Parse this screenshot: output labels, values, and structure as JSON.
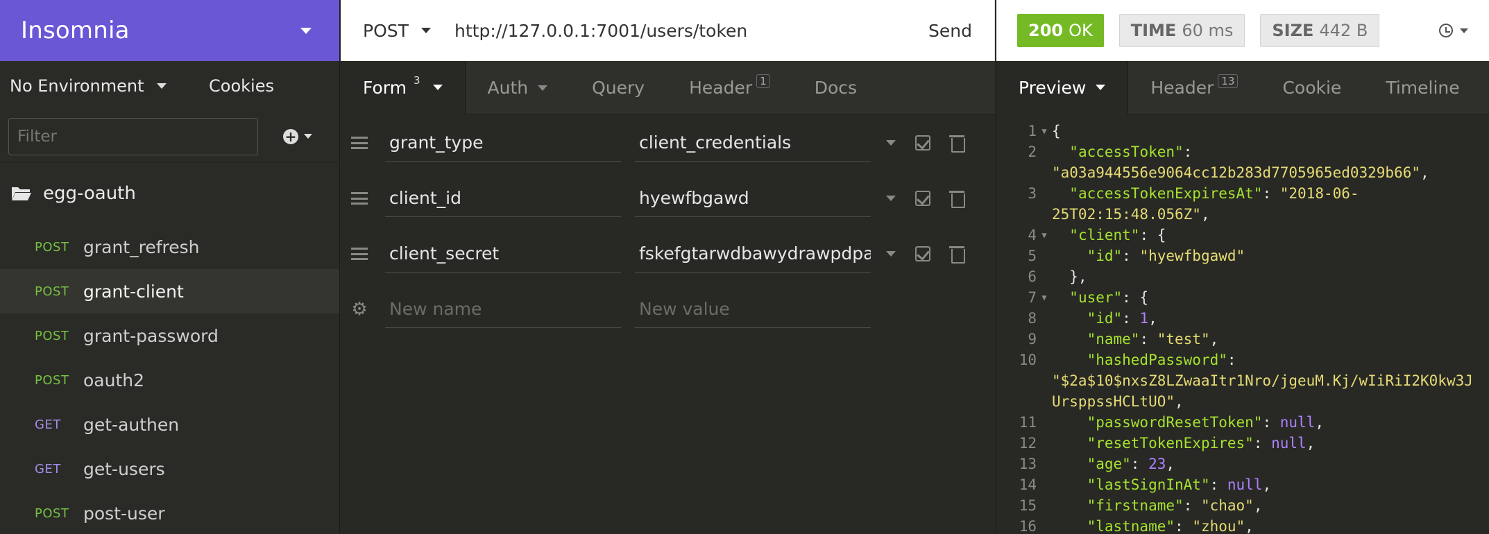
{
  "sidebar": {
    "app_title": "Insomnia",
    "environment": "No Environment",
    "cookies": "Cookies",
    "filter_placeholder": "Filter",
    "folder": "egg-oauth",
    "requests": [
      {
        "method": "POST",
        "name": "grant_refresh"
      },
      {
        "method": "POST",
        "name": "grant-client"
      },
      {
        "method": "POST",
        "name": "grant-password"
      },
      {
        "method": "POST",
        "name": "oauth2"
      },
      {
        "method": "GET",
        "name": "get-authen"
      },
      {
        "method": "GET",
        "name": "get-users"
      },
      {
        "method": "POST",
        "name": "post-user"
      }
    ]
  },
  "request": {
    "method": "POST",
    "url": "http://127.0.0.1:7001/users/token",
    "send_label": "Send",
    "tabs": {
      "form": "Form",
      "form_count": "3",
      "auth": "Auth",
      "query": "Query",
      "header": "Header",
      "header_count": "1",
      "docs": "Docs"
    },
    "params": [
      {
        "name": "grant_type",
        "value": "client_credentials"
      },
      {
        "name": "client_id",
        "value": "hyewfbgawd"
      },
      {
        "name": "client_secret",
        "value": "fskefgtarwdbawydrawpdpa"
      }
    ],
    "new_name_placeholder": "New name",
    "new_value_placeholder": "New value"
  },
  "response": {
    "status_code": "200",
    "status_text": "OK",
    "time_label": "TIME",
    "time_value": "60 ms",
    "size_label": "SIZE",
    "size_value": "442 B",
    "tabs": {
      "preview": "Preview",
      "header": "Header",
      "header_count": "13",
      "cookie": "Cookie",
      "timeline": "Timeline"
    },
    "lines": [
      {
        "n": "1",
        "fold": true,
        "html": "{"
      },
      {
        "n": "2",
        "fold": false,
        "parts": [
          [
            "",
            "  "
          ],
          [
            "k",
            "\"accessToken\""
          ],
          [
            "",
            ":"
          ]
        ]
      },
      {
        "n": "",
        "fold": false,
        "parts": [
          [
            "s",
            "\"a03a944556e9064cc12b283d7705965ed0329b66\""
          ],
          [
            "",
            ","
          ]
        ]
      },
      {
        "n": "3",
        "fold": false,
        "parts": [
          [
            "",
            "  "
          ],
          [
            "k",
            "\"accessTokenExpiresAt\""
          ],
          [
            "",
            ": "
          ],
          [
            "s",
            "\"2018-06-"
          ]
        ]
      },
      {
        "n": "",
        "fold": false,
        "parts": [
          [
            "s",
            "25T02:15:48.056Z\""
          ],
          [
            "",
            ","
          ]
        ]
      },
      {
        "n": "4",
        "fold": true,
        "parts": [
          [
            "",
            "  "
          ],
          [
            "k",
            "\"client\""
          ],
          [
            "",
            ": {"
          ]
        ]
      },
      {
        "n": "5",
        "fold": false,
        "parts": [
          [
            "",
            "    "
          ],
          [
            "k",
            "\"id\""
          ],
          [
            "",
            ": "
          ],
          [
            "s",
            "\"hyewfbgawd\""
          ]
        ]
      },
      {
        "n": "6",
        "fold": false,
        "parts": [
          [
            "",
            "  },"
          ]
        ]
      },
      {
        "n": "7",
        "fold": true,
        "parts": [
          [
            "",
            "  "
          ],
          [
            "k",
            "\"user\""
          ],
          [
            "",
            ": {"
          ]
        ]
      },
      {
        "n": "8",
        "fold": false,
        "parts": [
          [
            "",
            "    "
          ],
          [
            "k",
            "\"id\""
          ],
          [
            "",
            ": "
          ],
          [
            "n",
            "1"
          ],
          [
            "",
            ","
          ]
        ]
      },
      {
        "n": "9",
        "fold": false,
        "parts": [
          [
            "",
            "    "
          ],
          [
            "k",
            "\"name\""
          ],
          [
            "",
            ": "
          ],
          [
            "s",
            "\"test\""
          ],
          [
            "",
            ","
          ]
        ]
      },
      {
        "n": "10",
        "fold": false,
        "parts": [
          [
            "",
            "    "
          ],
          [
            "k",
            "\"hashedPassword\""
          ],
          [
            "",
            ":"
          ]
        ]
      },
      {
        "n": "",
        "fold": false,
        "parts": [
          [
            "s",
            "\"$2a$10$nxsZ8LZwaaItr1Nro/jgeuM.Kj/wIiRiI2K0kw3J"
          ]
        ]
      },
      {
        "n": "",
        "fold": false,
        "parts": [
          [
            "s",
            "UrsppssHCLtUO\""
          ],
          [
            "",
            ","
          ]
        ]
      },
      {
        "n": "11",
        "fold": false,
        "parts": [
          [
            "",
            "    "
          ],
          [
            "k",
            "\"passwordResetToken\""
          ],
          [
            "",
            ": "
          ],
          [
            "n",
            "null"
          ],
          [
            "",
            ","
          ]
        ]
      },
      {
        "n": "12",
        "fold": false,
        "parts": [
          [
            "",
            "    "
          ],
          [
            "k",
            "\"resetTokenExpires\""
          ],
          [
            "",
            ": "
          ],
          [
            "n",
            "null"
          ],
          [
            "",
            ","
          ]
        ]
      },
      {
        "n": "13",
        "fold": false,
        "parts": [
          [
            "",
            "    "
          ],
          [
            "k",
            "\"age\""
          ],
          [
            "",
            ": "
          ],
          [
            "n",
            "23"
          ],
          [
            "",
            ","
          ]
        ]
      },
      {
        "n": "14",
        "fold": false,
        "parts": [
          [
            "",
            "    "
          ],
          [
            "k",
            "\"lastSignInAt\""
          ],
          [
            "",
            ": "
          ],
          [
            "n",
            "null"
          ],
          [
            "",
            ","
          ]
        ]
      },
      {
        "n": "15",
        "fold": false,
        "parts": [
          [
            "",
            "    "
          ],
          [
            "k",
            "\"firstname\""
          ],
          [
            "",
            ": "
          ],
          [
            "s",
            "\"chao\""
          ],
          [
            "",
            ","
          ]
        ]
      },
      {
        "n": "16",
        "fold": false,
        "parts": [
          [
            "",
            "    "
          ],
          [
            "k",
            "\"lastname\""
          ],
          [
            "",
            ": "
          ],
          [
            "s",
            "\"zhou\""
          ],
          [
            "",
            ","
          ]
        ]
      }
    ]
  },
  "colors": {
    "brand": "#6a57d5",
    "status_ok": "#75ba24",
    "post": "#76c043",
    "get": "#a48be8"
  }
}
